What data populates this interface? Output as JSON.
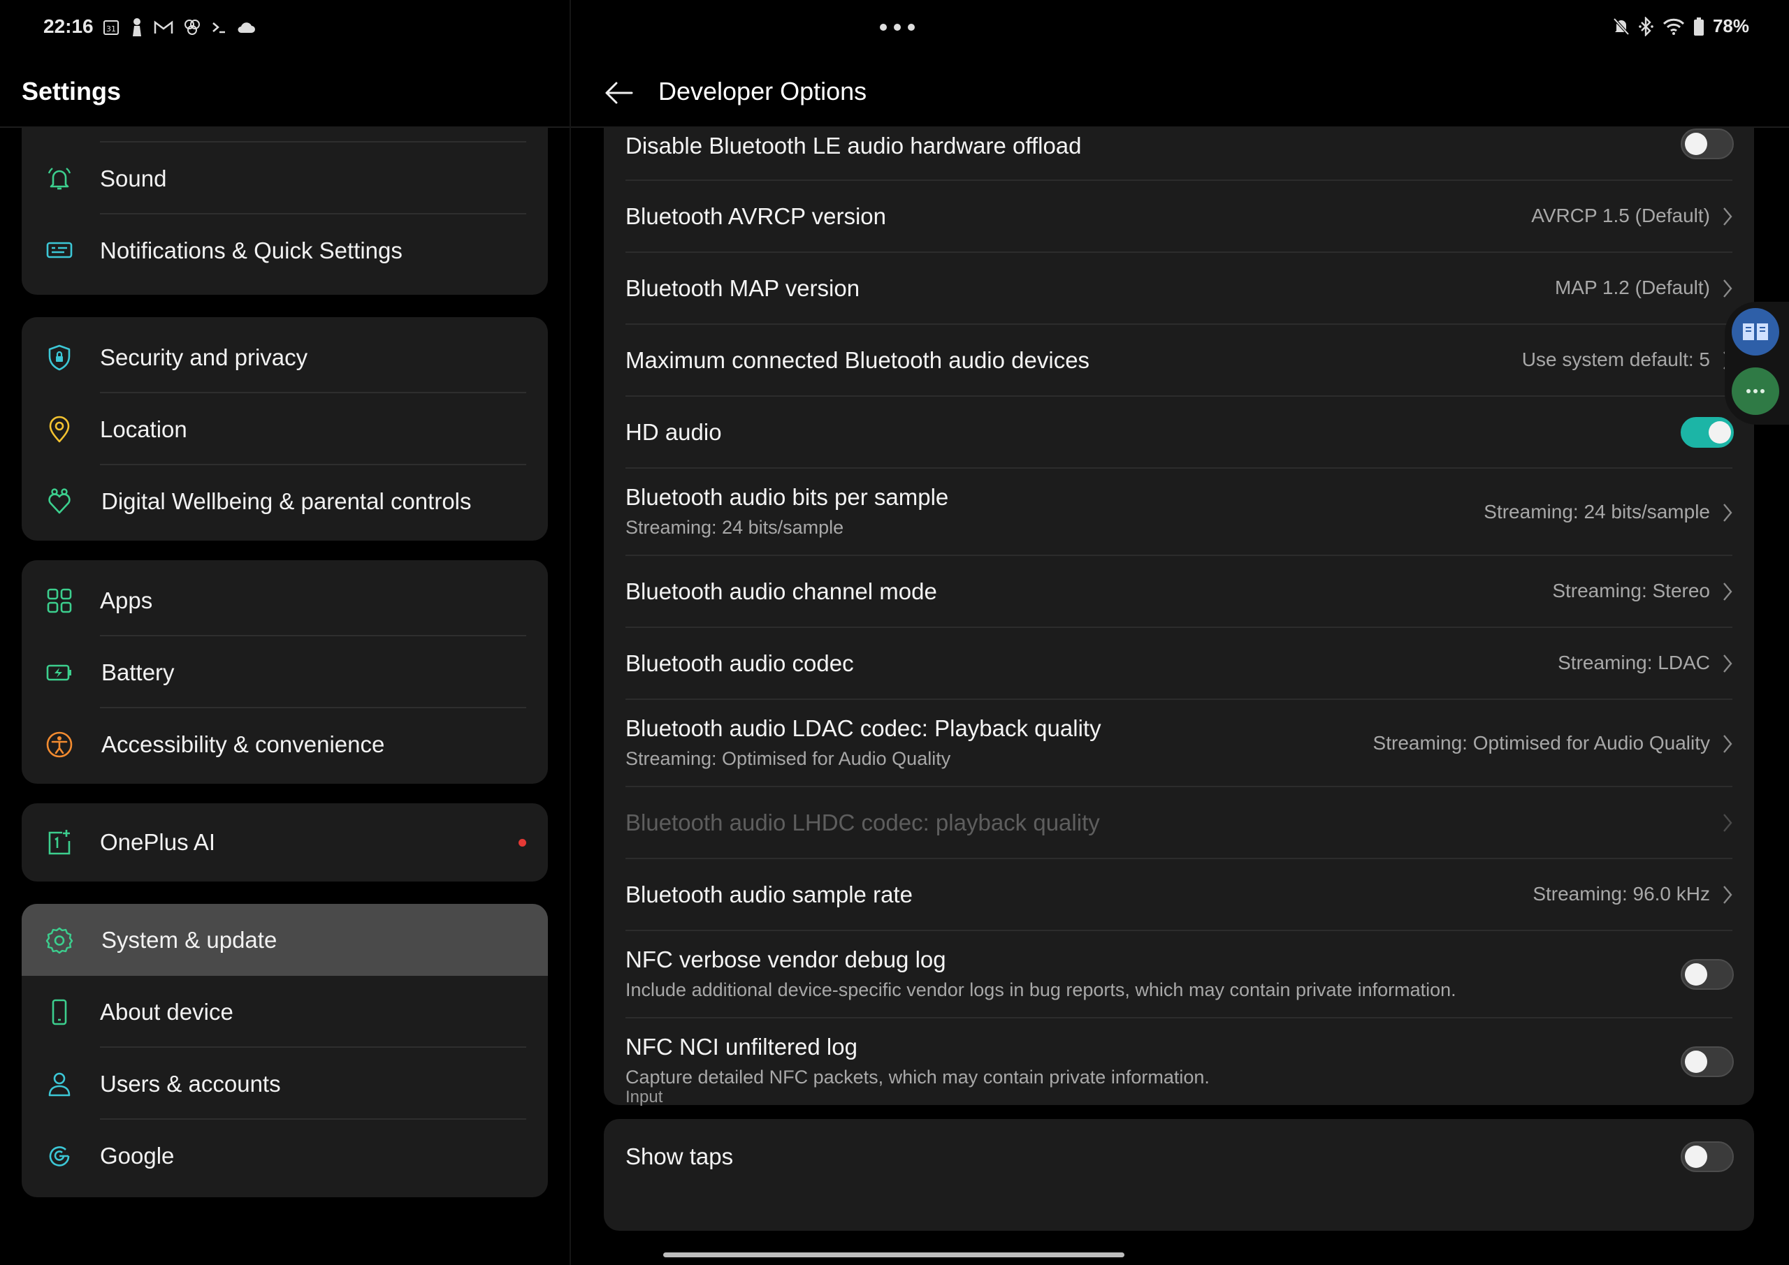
{
  "status_bar": {
    "time": "22:16",
    "left_icons": [
      "calendar-icon",
      "notification-figure-icon",
      "gmail-icon",
      "pinwheel-icon",
      "terminal-icon",
      "cloud-icon"
    ],
    "battery": "78%",
    "right_icons": [
      "mute-icon",
      "bluetooth-icon",
      "wifi-icon",
      "battery-icon"
    ]
  },
  "left_pane": {
    "title": "Settings",
    "groups": [
      {
        "items": [
          {
            "label": "Sound",
            "icon": "bell-icon"
          },
          {
            "label": "Notifications & Quick Settings",
            "icon": "notification-panel-icon"
          }
        ]
      },
      {
        "items": [
          {
            "label": "Security and privacy",
            "icon": "shield-icon"
          },
          {
            "label": "Location",
            "icon": "location-pin-icon"
          },
          {
            "label": "Digital Wellbeing & parental controls",
            "icon": "wellbeing-icon"
          }
        ]
      },
      {
        "items": [
          {
            "label": "Apps",
            "icon": "apps-grid-icon"
          },
          {
            "label": "Battery",
            "icon": "battery-charge-icon"
          },
          {
            "label": "Accessibility & convenience",
            "icon": "accessibility-icon"
          }
        ]
      },
      {
        "items": [
          {
            "label": "OnePlus AI",
            "icon": "oneplus-ai-icon",
            "badge": "red-dot"
          }
        ]
      },
      {
        "items": [
          {
            "label": "System & update",
            "icon": "gear-icon",
            "selected": true
          },
          {
            "label": "About device",
            "icon": "phone-icon"
          },
          {
            "label": "Users & accounts",
            "icon": "user-icon"
          },
          {
            "label": "Google",
            "icon": "google-icon"
          }
        ]
      }
    ]
  },
  "right_pane": {
    "title": "Developer Options",
    "items": [
      {
        "title": "Disable Bluetooth LE audio hardware offload",
        "type": "toggle",
        "on": false
      },
      {
        "title": "Bluetooth AVRCP version",
        "value": "AVRCP 1.5 (Default)",
        "type": "chevron"
      },
      {
        "title": "Bluetooth MAP version",
        "value": "MAP 1.2 (Default)",
        "type": "chevron"
      },
      {
        "title": "Maximum connected Bluetooth audio devices",
        "value": "Use system default: 5",
        "type": "chevron"
      },
      {
        "title": "HD audio",
        "type": "toggle",
        "on": true
      },
      {
        "title": "Bluetooth audio bits per sample",
        "subtitle": "Streaming: 24 bits/sample",
        "value": "Streaming: 24 bits/sample",
        "type": "chevron"
      },
      {
        "title": "Bluetooth audio channel mode",
        "value": "Streaming: Stereo",
        "type": "chevron"
      },
      {
        "title": "Bluetooth audio codec",
        "value": "Streaming: LDAC",
        "type": "chevron"
      },
      {
        "title": "Bluetooth audio LDAC codec: Playback quality",
        "subtitle": "Streaming: Optimised for Audio Quality",
        "value": "Streaming: Optimised for Audio Quality",
        "type": "chevron"
      },
      {
        "title": "Bluetooth audio LHDC codec: playback quality",
        "type": "chevron",
        "disabled": true
      },
      {
        "title": "Bluetooth audio sample rate",
        "value": "Streaming: 96.0 kHz",
        "type": "chevron"
      },
      {
        "title": "NFC verbose vendor debug log",
        "subtitle": "Include additional device-specific vendor logs in bug reports, which may contain private information.",
        "type": "toggle",
        "on": false
      },
      {
        "title": "NFC NCI unfiltered log",
        "subtitle": "Capture detailed NFC packets, which may contain private information.",
        "type": "toggle",
        "on": false
      }
    ],
    "section_input": {
      "label": "Input",
      "items": [
        {
          "title": "Show taps",
          "type": "toggle",
          "on": false
        }
      ]
    }
  },
  "floating_buttons": [
    "reader-icon",
    "more-icon"
  ],
  "colors": {
    "accent": "#1cb5a6",
    "icon_green": "#3ccf8e",
    "icon_orange": "#f28b30",
    "icon_yellow": "#f2c230",
    "icon_teal": "#3cc7d6"
  }
}
